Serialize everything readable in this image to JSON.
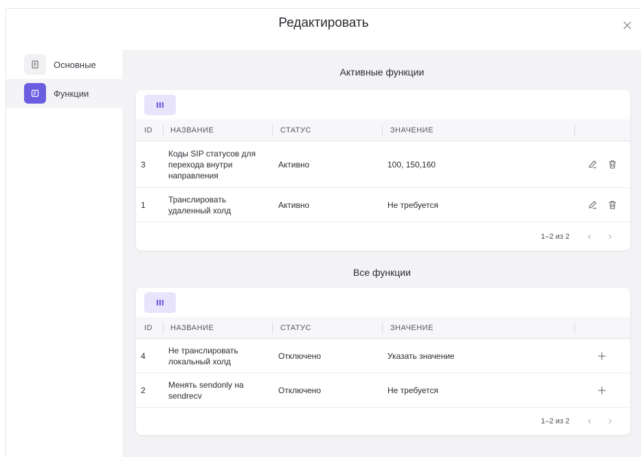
{
  "modal": {
    "title": "Редактировать"
  },
  "sidebar": {
    "items": [
      {
        "label": "Основные",
        "icon": "document-icon",
        "active": false
      },
      {
        "label": "Функции",
        "icon": "function-icon",
        "active": true
      }
    ]
  },
  "active_section": {
    "title": "Активные функции",
    "columns": [
      "ID",
      "НАЗВАНИЕ",
      "СТАТУС",
      "ЗНАЧЕНИЕ"
    ],
    "rows": [
      {
        "id": "3",
        "name": "Коды SIP статусов для перехода внутри направления",
        "status": "Активно",
        "value": "100, 150,160"
      },
      {
        "id": "1",
        "name": "Транслировать удаленный холд",
        "status": "Активно",
        "value": "Не требуется"
      }
    ],
    "pagination": "1–2 из 2"
  },
  "all_section": {
    "title": "Все функции",
    "columns": [
      "ID",
      "НАЗВАНИЕ",
      "СТАТУС",
      "ЗНАЧЕНИЕ"
    ],
    "rows": [
      {
        "id": "4",
        "name": "Не транслировать локальный холд",
        "status": "Отключено",
        "value": "Указать значение"
      },
      {
        "id": "2",
        "name": "Менять sendonly на sendrecv",
        "status": "Отключено",
        "value": "Не требуется"
      }
    ],
    "pagination": "1–2 из 2"
  },
  "colors": {
    "accent": "#6b5de0",
    "accent_light": "#e7e4fb",
    "panel_bg": "#f3f3f6"
  }
}
